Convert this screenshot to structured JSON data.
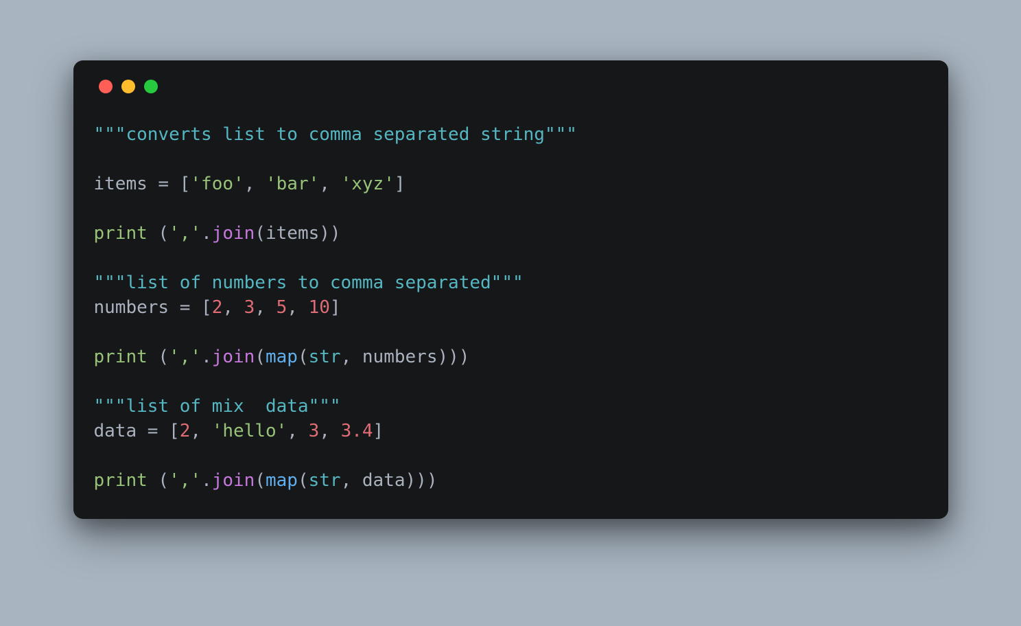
{
  "window": {
    "traffic_lights": [
      "red",
      "yellow",
      "green"
    ]
  },
  "code": {
    "docstring1": "\"\"\"converts list to comma separated string\"\"\"",
    "line_items_decl": "items",
    "eq": " = ",
    "lbracket": "[",
    "rbracket": "]",
    "items_list": {
      "val1": "'foo'",
      "sep1": ", ",
      "val2": "'bar'",
      "sep2": ", ",
      "val3": "'xyz'"
    },
    "print_kw": "print",
    "space_paren": " (",
    "comma_lit": "','",
    "dot": ".",
    "join": "join",
    "lparen": "(",
    "rparen": ")",
    "rparen2": "))",
    "rparen3": ")))",
    "items_ref": "items",
    "docstring2": "\"\"\"list of numbers to comma separated\"\"\"",
    "numbers_decl": "numbers",
    "numbers_list": {
      "n1": "2",
      "s1": ", ",
      "n2": "3",
      "s2": ", ",
      "n3": "5",
      "s3": ", ",
      "n4": "10"
    },
    "map_kw": "map",
    "str_kw": "str",
    "comma_space": ", ",
    "numbers_ref": "numbers",
    "docstring3": "\"\"\"list of mix  data\"\"\"",
    "data_decl": "data",
    "data_list": {
      "v1": "2",
      "s1": ", ",
      "v2": "'hello'",
      "s2": ", ",
      "v3": "3",
      "s3": ", ",
      "v4": "3.4"
    },
    "data_ref": "data"
  }
}
